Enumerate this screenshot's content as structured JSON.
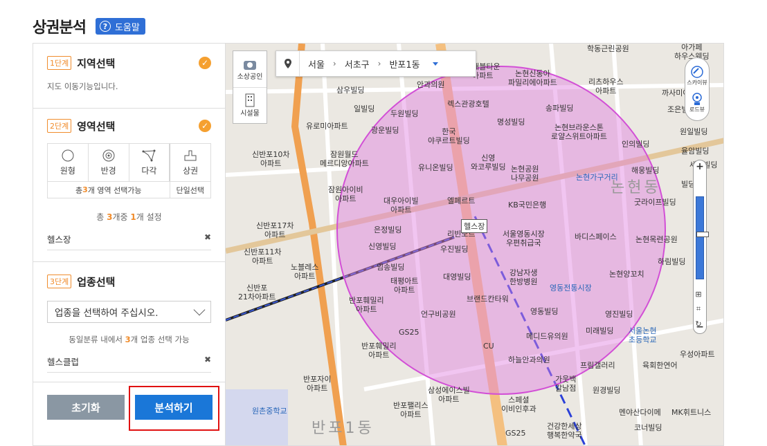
{
  "header": {
    "title": "상권분석",
    "help_label": "도움말"
  },
  "panel": {
    "step1": {
      "badge": "1단계",
      "title": "지역선택",
      "hint": "지도 이동기능입니다."
    },
    "step2": {
      "badge": "2단계",
      "title": "영역선택",
      "shapes": [
        {
          "label": "원형",
          "icon": "circle-icon"
        },
        {
          "label": "반경",
          "icon": "radius-icon"
        },
        {
          "label": "다각",
          "icon": "polygon-icon"
        },
        {
          "label": "상권",
          "icon": "district-icon"
        }
      ],
      "foot_prefix": "총 ",
      "foot_count": "3",
      "foot_suffix": " 개 영역 선택가능",
      "foot_right": "단일선택",
      "count_prefix": "총 ",
      "count_total": "3",
      "count_mid": "개중 ",
      "count_sel": "1",
      "count_suffix": "개 설정",
      "selected": "헬스장"
    },
    "step3": {
      "badge": "3단계",
      "title": "업종선택",
      "select_placeholder": "업종을 선택하여 주십시오.",
      "count_prefix": "동일분류 내에서 ",
      "count_num": "3",
      "count_suffix": "개 업종 선택 가능",
      "selected": "헬스클럽"
    },
    "reset_label": "초기화",
    "analyze_label": "분석하기"
  },
  "map": {
    "location": {
      "city": "서울",
      "district": "서초구",
      "dong": "반포1동"
    },
    "tools": {
      "sosang": "소상공인",
      "facility": "시설물"
    },
    "right_tools": {
      "skyview": "스카이뷰",
      "roadview": "로드뷰"
    },
    "marker": "헬스장",
    "labels": {
      "a1": "학동근린공원",
      "a2": "아가페\n하우스웨딩",
      "a3": "삼우빌딩",
      "a4": "논현신동아\n파밀리에아파트",
      "a5": "렉스관광호텔",
      "a6": "송파빌딩",
      "a7": "일빌딩",
      "a8": "두원빌딩",
      "a9": "유로미아파트",
      "a10": "광운빌딩",
      "a11": "한국\n야쿠르트빌딩",
      "a12": "명성빌딩",
      "a13": "논현브라운스톤\n로얄스위트아파트",
      "a14": "인의빌딩",
      "a15": "신반포10차\n아파트",
      "a16": "잠원월드\n메르디앙아파트",
      "a17": "유니온빌딩",
      "a18": "신영\n와코루빌딩",
      "a19": "논현공원\n나무공원",
      "a20": "논현가구거리",
      "a21": "해웅빌딩",
      "a22": "잠원아이비\n아파트",
      "a23": "대우아이빌\n아파트",
      "a24": "엘페르트",
      "a25": "KB국민은행",
      "a26": "굿라이프빌딩",
      "a27": "신반포17차\n아파트",
      "a28": "은정빌딩",
      "a29": "서울영동시장\n우편취급국",
      "a30": "바디스페이스",
      "a31": "논현목련공원",
      "a32": "신영빌딩",
      "a33": "우진빌딩",
      "a34": "신반포11차\n아파트",
      "a35": "노블레스\n아파트",
      "a36": "임송빌딩",
      "a37": "대영빌딩",
      "a38": "강남자생\n한방병원",
      "a39": "논현양꼬치",
      "a40": "하림빌딩",
      "a41": "신반포\n21차아파트",
      "a42": "태평아트\n아파트",
      "a43": "영동전통시장",
      "a44": "반포훼밀리\n아파트",
      "a45": "브랜드칸타워",
      "a46": "영동빌딩",
      "a47": "영진빌딩",
      "a48": "언구비공원",
      "a49": "서울논현\n초등학교",
      "a50": "GS25",
      "a51": "메디드유의원",
      "a52": "미래빌딩",
      "a53": "CU",
      "a54": "반포훼밀리\n아파트",
      "a55": "하늘안과의원",
      "a56": "프림갤러리",
      "a57": "육회한연어",
      "a58": "우성아파트",
      "a59": "반포자이\n아파트",
      "a60": "삼성에이스빌\n아파트",
      "a61": "가웃백\n갈남점",
      "a62": "원경빌딩",
      "a63": "스페셜\n이비인후과",
      "a64": "반포팰리스\n아파트",
      "a65": "원촌중학교",
      "a66": "멘야산다이메",
      "a67": "MK휘트니스",
      "a68": "건강한세상\n행복한약국",
      "a69": "코너빌딩",
      "a70": "반포1동",
      "a71": "논현동",
      "a72": "GS25",
      "a73": "까사미아",
      "a74": "조은빌딩",
      "a75": "원일빌딩",
      "a76": "율암빌딩",
      "a77": "세왕빌딩",
      "a78": "리츠하우스\n아파트",
      "a79": "현대블타운\n아파트",
      "a80": "안과의원",
      "a81": "리빈모르",
      "a82": "빌딩"
    }
  }
}
